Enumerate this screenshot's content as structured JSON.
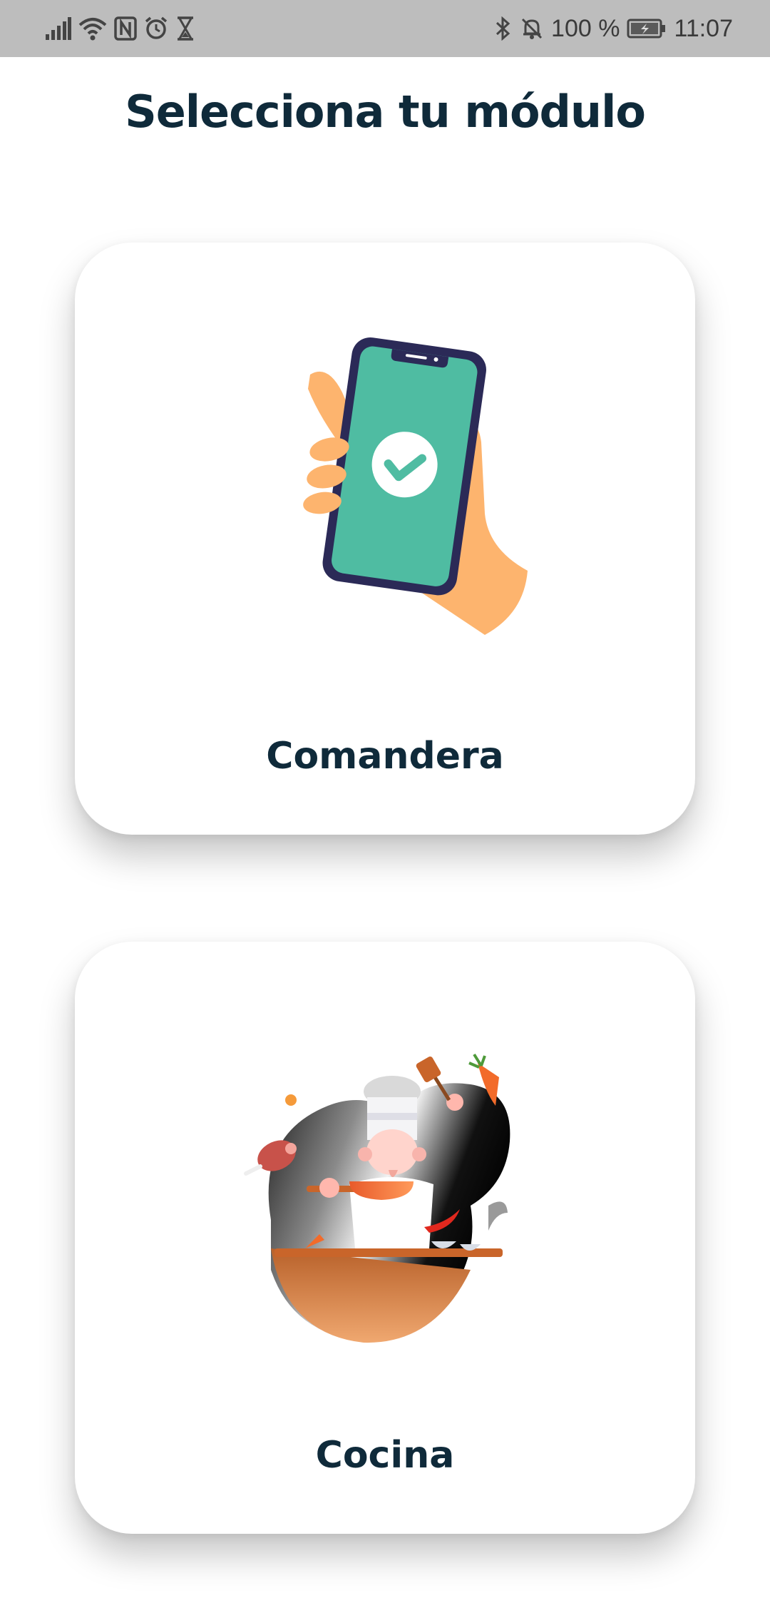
{
  "status_bar": {
    "battery_text": "100 %",
    "time": "11:07",
    "icons": [
      "signal-icon",
      "wifi-icon",
      "nfc-icon",
      "alarm-icon",
      "hourglass-icon",
      "bluetooth-icon",
      "mute-icon",
      "battery-charging-icon"
    ]
  },
  "header": {
    "title": "Selecciona tu módulo"
  },
  "modules": [
    {
      "label": "Comandera",
      "icon": "phone-check-icon"
    },
    {
      "label": "Cocina",
      "icon": "chef-icon"
    }
  ],
  "colors": {
    "title_text": "#0f2a3a",
    "status_bar_bg": "#bdbdbd",
    "phone_screen": "#4fbca2",
    "hand": "#fdb46e",
    "phone_frame": "#2b2a57"
  }
}
